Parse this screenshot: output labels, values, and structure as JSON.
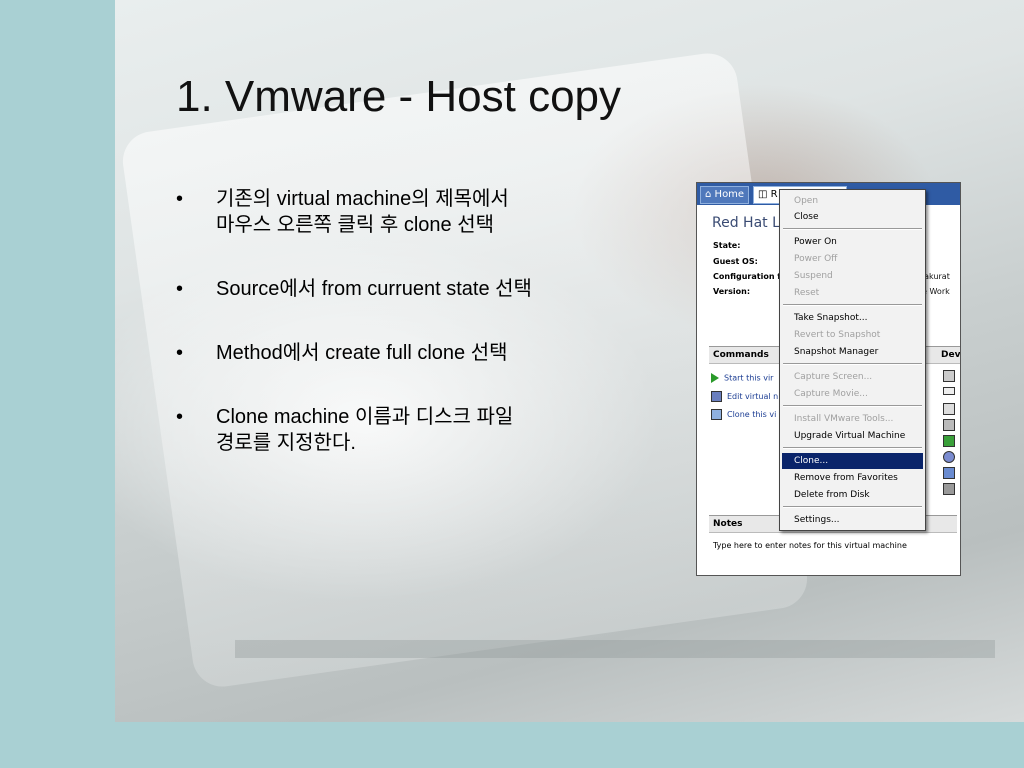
{
  "slide": {
    "title": "1. Vmware - Host copy",
    "bullet_char": "•",
    "bullets": [
      "기존의 virtual machine의 제목에서\n마우스 오른쪽 클릭 후 clone 선택",
      "Source에서 from curruent state 선택",
      "Method에서 create full clone 선택",
      "Clone machine 이름과 디스크 파일\n경로를 지정한다."
    ]
  },
  "vmware": {
    "tabs": {
      "home": "Home",
      "vm": "R"
    },
    "vm_name": "Red Hat L",
    "fields": [
      {
        "label": "State:",
        "value": ""
      },
      {
        "label": "Guest OS:",
        "value": ""
      },
      {
        "label": "Configuration f",
        "value": "hSakurat"
      },
      {
        "label": "Version:",
        "value": "are Work"
      }
    ],
    "commands_header": "Commands",
    "devices_header": "Dev",
    "commands": [
      "Start this vir",
      "Edit virtual n",
      "Clone this vi"
    ],
    "notes_header": "Notes",
    "notes_text": "Type here to enter notes for this virtual machine",
    "colors": {
      "tabbar": "#2f5ba4",
      "command_link": "#1d3e94",
      "menu_highlight": "#0a246a"
    }
  },
  "context_menu": {
    "items": [
      {
        "label": "Open",
        "disabled": true
      },
      {
        "label": "Close",
        "disabled": false
      },
      {
        "label": "Power On",
        "disabled": false
      },
      {
        "label": "Power Off",
        "disabled": true
      },
      {
        "label": "Suspend",
        "disabled": true
      },
      {
        "label": "Reset",
        "disabled": true
      },
      {
        "label": "Take Snapshot...",
        "disabled": false
      },
      {
        "label": "Revert to Snapshot",
        "disabled": true
      },
      {
        "label": "Snapshot Manager",
        "disabled": false
      },
      {
        "label": "Capture Screen...",
        "disabled": true
      },
      {
        "label": "Capture Movie...",
        "disabled": true
      },
      {
        "label": "Install VMware Tools...",
        "disabled": true
      },
      {
        "label": "Upgrade Virtual Machine",
        "disabled": false
      },
      {
        "label": "Clone...",
        "disabled": false,
        "highlighted": true
      },
      {
        "label": "Remove from Favorites",
        "disabled": false
      },
      {
        "label": "Delete from Disk",
        "disabled": false
      },
      {
        "label": "Settings...",
        "disabled": false
      }
    ]
  }
}
